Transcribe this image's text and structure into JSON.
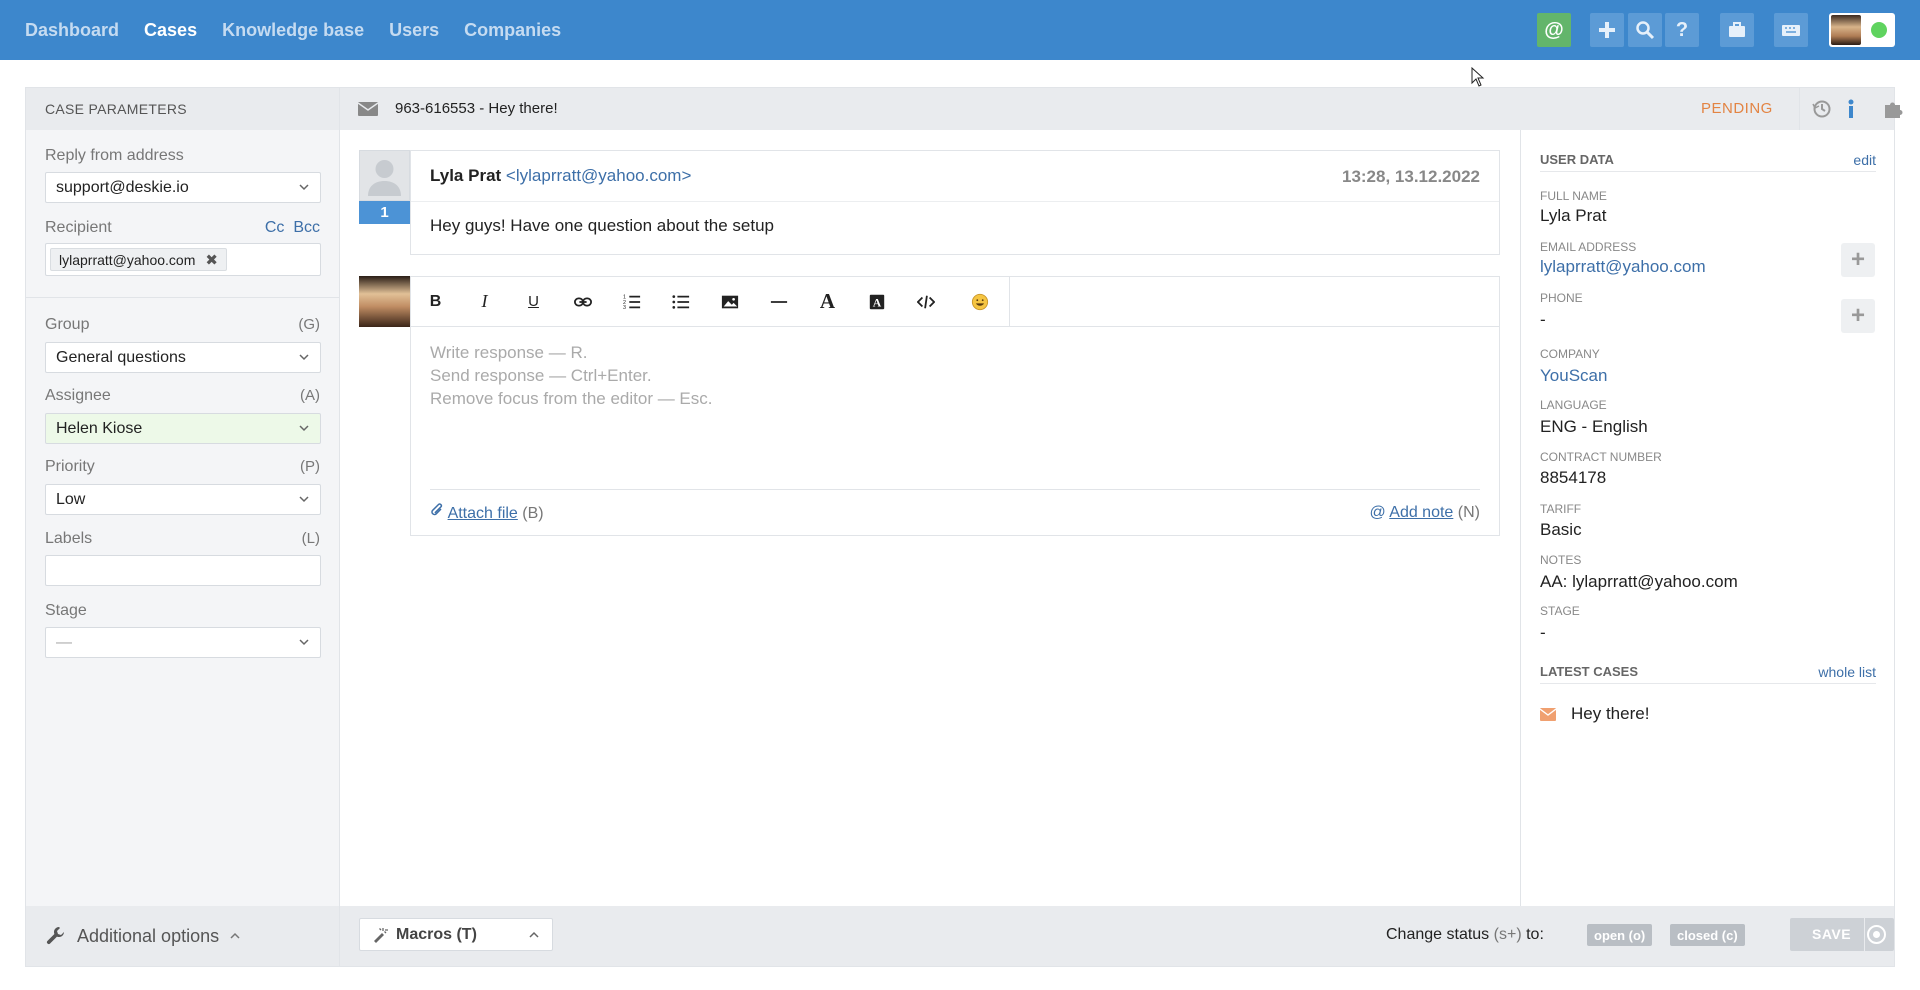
{
  "nav": {
    "items": [
      {
        "label": "Dashboard",
        "active": false
      },
      {
        "label": "Cases",
        "active": true
      },
      {
        "label": "Knowledge base",
        "active": false
      },
      {
        "label": "Users",
        "active": false
      },
      {
        "label": "Companies",
        "active": false
      }
    ],
    "at_label": "@"
  },
  "params": {
    "title": "CASE PARAMETERS",
    "reply_label": "Reply from address",
    "reply_value": "support@deskie.io",
    "recipient_label": "Recipient",
    "cc": "Cc",
    "bcc": "Bcc",
    "recipient_tag": "lylaprratt@yahoo.com",
    "group_label": "Group",
    "group_key": "(G)",
    "group_value": "General questions",
    "assignee_label": "Assignee",
    "assignee_key": "(A)",
    "assignee_value": "Helen Kiose",
    "priority_label": "Priority",
    "priority_key": "(P)",
    "priority_value": "Low",
    "labels_label": "Labels",
    "labels_key": "(L)",
    "stage_label": "Stage",
    "stage_value": "—",
    "additional_options": "Additional options"
  },
  "case": {
    "title": "963-616553 - Hey there!",
    "status": "PENDING"
  },
  "message": {
    "number": "1",
    "sender_name": "Lyla Prat",
    "sender_email": "<lylaprratt@yahoo.com>",
    "time": "13:28, 13.12.2022",
    "text": "Hey guys! Have one question about the setup"
  },
  "editor": {
    "placeholder_lines": [
      "Write response — R.",
      "Send response — Ctrl+Enter.",
      "Remove focus from the editor — Esc."
    ],
    "attach_label": "Attach file",
    "attach_key": "(B)",
    "note_label": "Add note",
    "note_key": "(N)"
  },
  "footer": {
    "macros_label": "Macros (T)",
    "change_status_label": "Change status",
    "change_status_key": "(s+)",
    "change_status_to": "to:",
    "open_label": "open (o)",
    "closed_label": "closed (c)",
    "save_label": "SAVE"
  },
  "user_data": {
    "title": "USER DATA",
    "edit_label": "edit",
    "full_name_label": "FULL NAME",
    "full_name": "Lyla Prat",
    "email_label": "EMAIL ADDRESS",
    "email": "lylaprratt@yahoo.com",
    "phone_label": "PHONE",
    "phone": "-",
    "company_label": "COMPANY",
    "company": "YouScan",
    "language_label": "LANGUAGE",
    "language": "ENG - English",
    "contract_label": "CONTRACT NUMBER",
    "contract": "8854178",
    "tariff_label": "TARIFF",
    "tariff": "Basic",
    "notes_label": "NOTES",
    "notes": "AA: lylaprratt@yahoo.com",
    "stage_label": "STAGE",
    "stage": "-",
    "latest_title": "LATEST CASES",
    "whole_list_label": "whole list",
    "latest_case": "Hey there!"
  },
  "colors": {
    "topbar": "#3d87cc",
    "pending": "#e38443",
    "link": "#3d6fa8",
    "assignee_bg": "#edf9e8"
  }
}
